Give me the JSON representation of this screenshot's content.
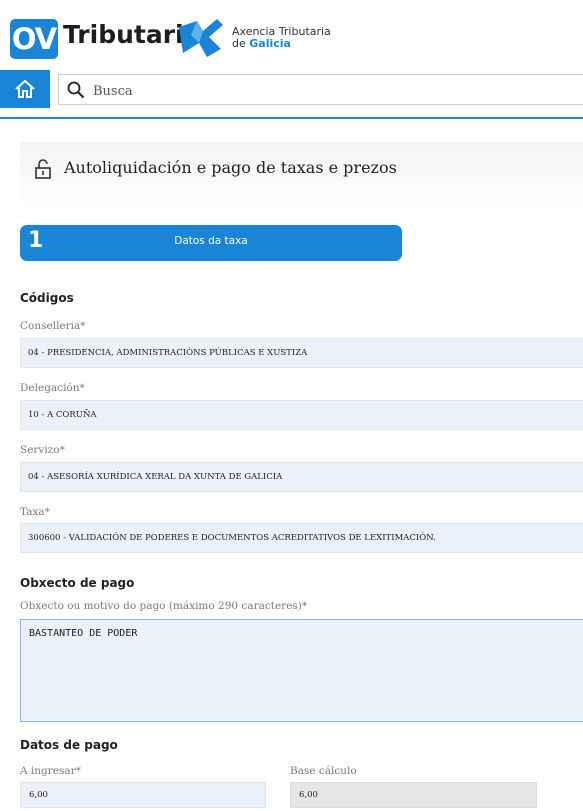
{
  "header": {
    "ov_badge": "OV",
    "ov_word": "Tributaria",
    "agency_line1": "Axencia Tributaria",
    "agency_line2_prefix": "de ",
    "agency_line2_brand": "Galicia",
    "brand_color": "#1a84d6"
  },
  "nav": {
    "home_icon": "home-icon",
    "search_placeholder": "Busca"
  },
  "page": {
    "title": "Autoliquidación e pago de taxas e prezos",
    "title_icon": "lock-icon"
  },
  "step": {
    "number": "1",
    "label": "Datos da taxa"
  },
  "codigos": {
    "heading": "Códigos",
    "conselleria_label": "Conselleria*",
    "conselleria_value": "04 - PRESIDENCIA, ADMINISTRACIÓNS PÚBLICAS E XUSTIZA",
    "delegacion_label": "Delegación*",
    "delegacion_value": "10 - A CORUÑA",
    "servizo_label": "Servizo*",
    "servizo_value": "04 - ASESORÍA XURÍDICA XERAL DA XUNTA DE GALICIA",
    "taxa_label": "Taxa*",
    "taxa_value": "300600 - VALIDACIÓN DE PODERES E DOCUMENTOS ACREDITATIVOS DE LEXITIMACIÓN."
  },
  "obxecto": {
    "heading": "Obxecto de pago",
    "motivo_label": "Obxecto ou motivo do pago (máximo 290 caracteres)*",
    "motivo_value": "BASTANTEO DE PODER"
  },
  "datos_pago": {
    "heading": "Datos de pago",
    "a_ingresar_label": "A ingresar*",
    "a_ingresar_value": "6,00",
    "base_calculo_label": "Base cálculo",
    "base_calculo_value": "6,00"
  }
}
